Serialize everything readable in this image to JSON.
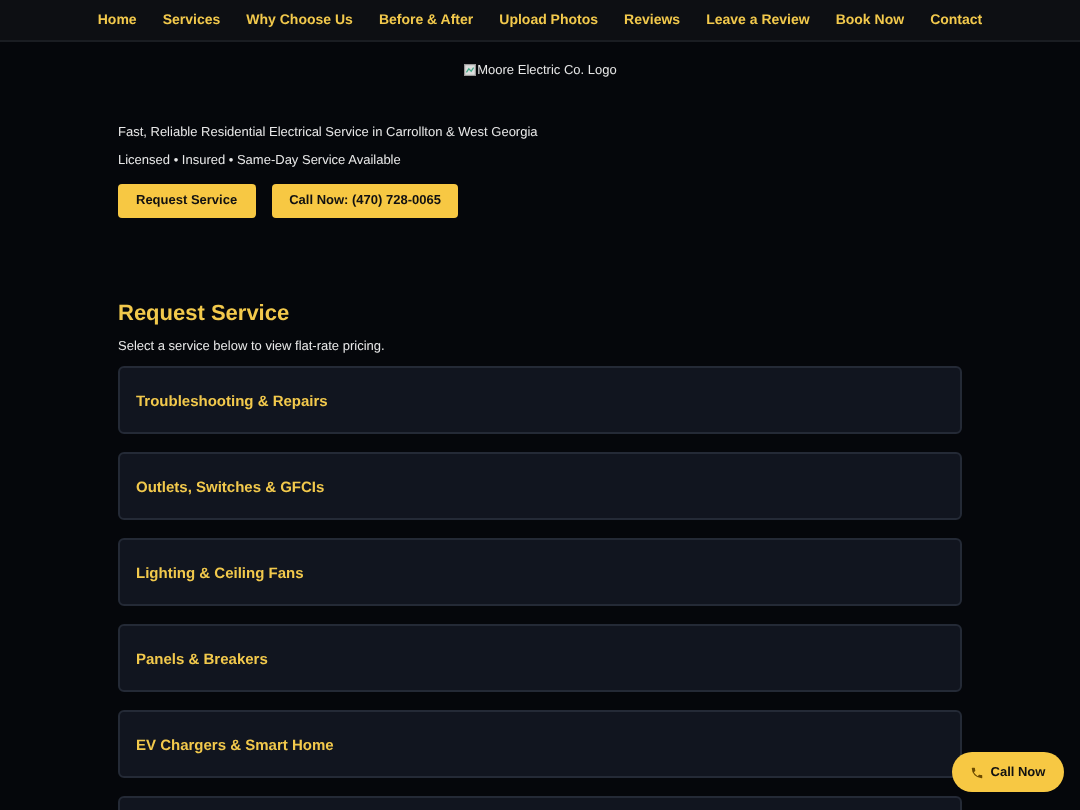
{
  "nav": {
    "items": [
      {
        "label": "Home"
      },
      {
        "label": "Services"
      },
      {
        "label": "Why Choose Us"
      },
      {
        "label": "Before & After"
      },
      {
        "label": "Upload Photos"
      },
      {
        "label": "Reviews"
      },
      {
        "label": "Leave a Review"
      },
      {
        "label": "Book Now"
      },
      {
        "label": "Contact"
      }
    ]
  },
  "logo": {
    "alt": "Moore Electric Co. Logo"
  },
  "hero": {
    "tagline": "Fast, Reliable Residential Electrical Service in Carrollton & West Georgia",
    "badges": "Licensed • Insured • Same-Day Service Available",
    "buttons": [
      "Request Service",
      "Call Now: (470) 728-0065"
    ]
  },
  "request": {
    "title": "Request Service",
    "intro": "Select a service below to view flat-rate pricing.",
    "services": [
      {
        "title": "Troubleshooting & Repairs"
      },
      {
        "title": "Outlets, Switches & GFCIs"
      },
      {
        "title": "Lighting & Ceiling Fans"
      },
      {
        "title": "Panels & Breakers"
      },
      {
        "title": "EV Chargers & Smart Home"
      }
    ]
  },
  "floating_button": {
    "label": "Call Now"
  }
}
